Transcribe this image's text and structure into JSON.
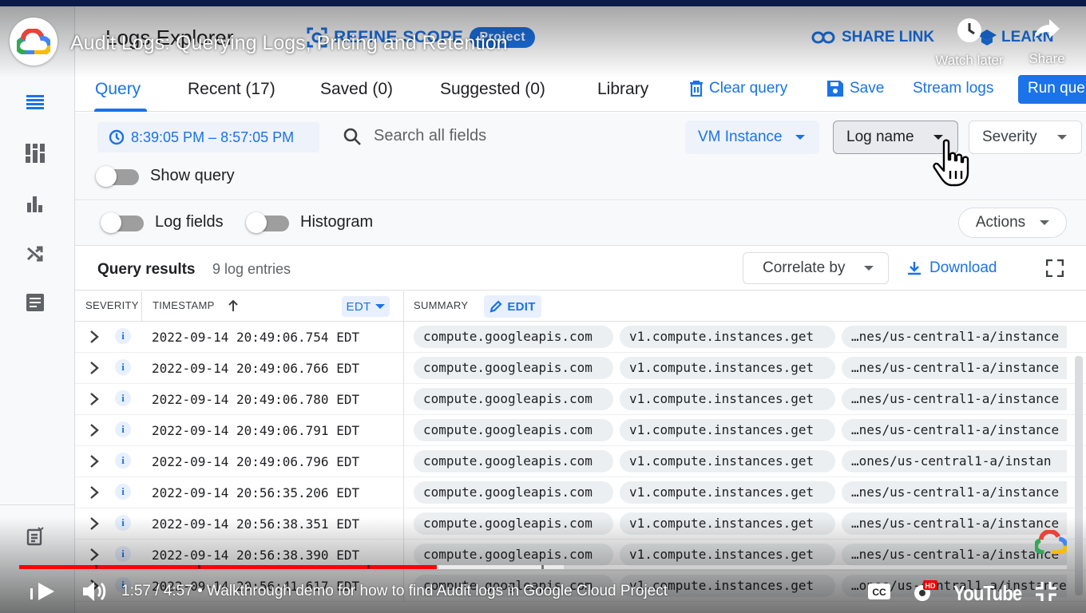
{
  "app": {
    "title": "Logs Explorer",
    "refine_scope": "REFINE SCOPE",
    "scope_chip": "Project",
    "share_link": "SHARE LINK",
    "learn": "LEARN"
  },
  "youtube": {
    "video_title": "Audit Logs: Querying Logs, Pricing and Retention",
    "watch_later": "Watch later",
    "share": "Share",
    "time": "1:57 / 4:57",
    "chapter": "• Walkthrough demo for how to find Audit logs in Google Cloud Project",
    "wordmark": "YouTube",
    "played_fraction": 0.399,
    "buffered_fraction": 0.52,
    "hd_badge": "HD"
  },
  "tabs": {
    "query": "Query",
    "recent": "Recent (17)",
    "saved": "Saved (0)",
    "suggested": "Suggested (0)",
    "library": "Library",
    "clear_query": "Clear query",
    "save": "Save",
    "stream_logs": "Stream logs",
    "run_query": "Run query"
  },
  "query": {
    "time_range": "8:39:05 PM – 8:57:05 PM",
    "search_placeholder": "Search all fields",
    "filter_resource": "VM Instance",
    "filter_log_name": "Log name",
    "filter_severity": "Severity",
    "show_query": "Show query"
  },
  "options": {
    "log_fields": "Log fields",
    "histogram": "Histogram",
    "actions": "Actions"
  },
  "results": {
    "title": "Query results",
    "count": "9 log entries",
    "correlate_by": "Correlate by",
    "download": "Download"
  },
  "table": {
    "col_severity": "SEVERITY",
    "col_timestamp": "TIMESTAMP",
    "tz": "EDT",
    "col_summary": "SUMMARY",
    "edit": "EDIT",
    "rows": [
      {
        "sev": "i",
        "ts": "2022-09-14 20:49:06.754 EDT",
        "service": "compute.googleapis.com",
        "method": "v1.compute.instances.get",
        "resource": "…nes/us-central1-a/instance"
      },
      {
        "sev": "i",
        "ts": "2022-09-14 20:49:06.766 EDT",
        "service": "compute.googleapis.com",
        "method": "v1.compute.instances.get",
        "resource": "…nes/us-central1-a/instance"
      },
      {
        "sev": "i",
        "ts": "2022-09-14 20:49:06.780 EDT",
        "service": "compute.googleapis.com",
        "method": "v1.compute.instances.get",
        "resource": "…nes/us-central1-a/instance"
      },
      {
        "sev": "i",
        "ts": "2022-09-14 20:49:06.791 EDT",
        "service": "compute.googleapis.com",
        "method": "v1.compute.instances.get",
        "resource": "…nes/us-central1-a/instance"
      },
      {
        "sev": "i",
        "ts": "2022-09-14 20:49:06.796 EDT",
        "service": "compute.googleapis.com",
        "method": "v1.compute.instances.get",
        "resource": "…ones/us-central1-a/instan"
      },
      {
        "sev": "i",
        "ts": "2022-09-14 20:56:35.206 EDT",
        "service": "compute.googleapis.com",
        "method": "v1.compute.instances.get",
        "resource": "…nes/us-central1-a/instance"
      },
      {
        "sev": "i",
        "ts": "2022-09-14 20:56:38.351 EDT",
        "service": "compute.googleapis.com",
        "method": "v1.compute.instances.get",
        "resource": "…nes/us-central1-a/instance"
      },
      {
        "sev": "i",
        "ts": "2022-09-14 20:56:38.390 EDT",
        "service": "compute.googleapis.com",
        "method": "v1.compute.instances.get",
        "resource": "…nes/us-central1-a/instance"
      },
      {
        "sev": "i",
        "ts": "2022-09-14 20:56:41.617 EDT",
        "service": "compute.googleapis.com",
        "method": "v1.compute.instances.get",
        "resource": "…ones/us-central1-a/instance"
      }
    ]
  },
  "colors": {
    "accent": "#1a73e8",
    "progress": "#ff0000"
  }
}
